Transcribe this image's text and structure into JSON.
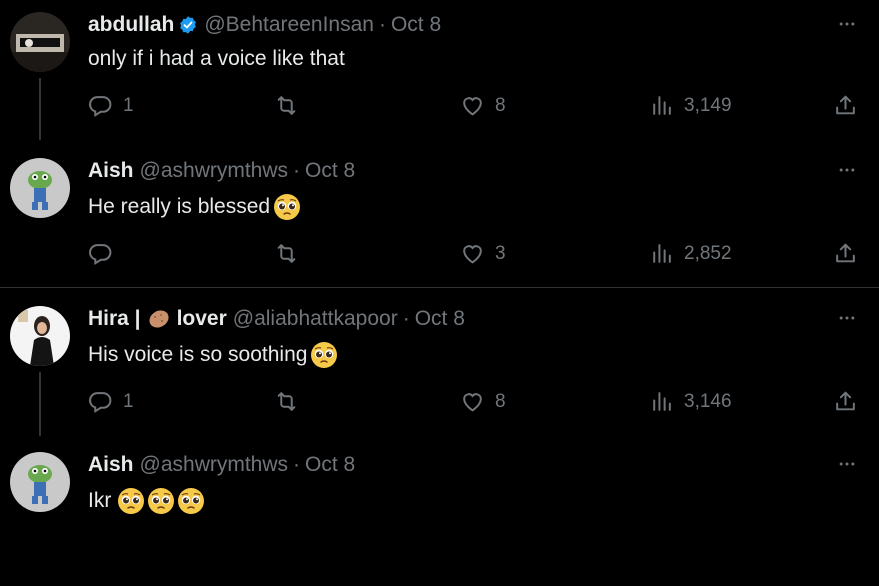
{
  "tweets": [
    {
      "name": "abdullah",
      "verified": true,
      "handle": "@BehtareenInsan",
      "dot": "·",
      "date": "Oct 8",
      "text": "only if i had a voice like that",
      "replies": "1",
      "retweets": "",
      "likes": "8",
      "views": "3,149"
    },
    {
      "name": "Aish",
      "handle": "@ashwrymthws",
      "dot": "·",
      "date": "Oct 8",
      "text": "He really is blessed",
      "replies": "",
      "retweets": "",
      "likes": "3",
      "views": "2,852"
    },
    {
      "name_prefix": "Hira |",
      "name_suffix": "lover",
      "handle": "@aliabhattkapoor",
      "dot": "·",
      "date": "Oct 8",
      "text": "His voice is so soothing",
      "replies": "1",
      "retweets": "",
      "likes": "8",
      "views": "3,146"
    },
    {
      "name": "Aish",
      "handle": "@ashwrymthws",
      "dot": "·",
      "date": "Oct 8",
      "text": "Ikr"
    }
  ],
  "colors": {
    "background": "#000000",
    "text": "#e7e9ea",
    "muted": "#71767b",
    "verified": "#1d9bf0",
    "thread_line": "#333639",
    "divider": "#2f3336"
  },
  "icons": [
    "reply-icon",
    "retweet-icon",
    "like-icon",
    "views-icon",
    "share-icon",
    "more-icon",
    "verified-badge-icon",
    "pleading-face-emoji",
    "potato-emoji"
  ]
}
